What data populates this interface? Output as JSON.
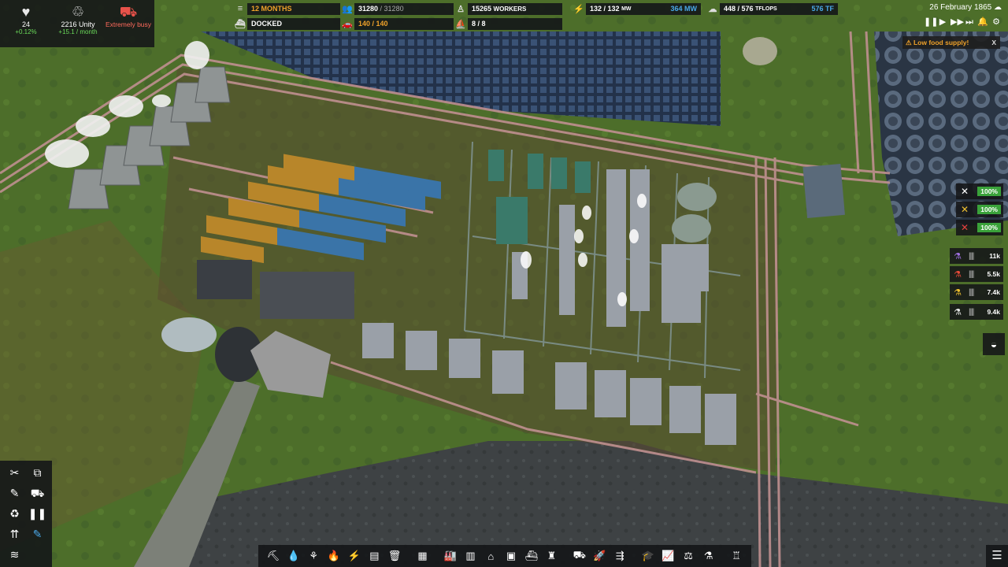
{
  "stats": {
    "health": {
      "icon": "heart-pulse-icon",
      "value": "24",
      "sub": "+0.12%"
    },
    "unity": {
      "icon": "unity-icon",
      "value": "2216 Unity",
      "sub": "+15.1 / month"
    },
    "logistics": {
      "icon": "truck-icon",
      "label": "Extremely busy"
    }
  },
  "topbar": {
    "food_months": "12 MONTHS",
    "ship_status": "DOCKED",
    "population": "31280",
    "population_max": "/ 31280",
    "workers": "15265",
    "workers_label": "WORKERS",
    "vehicles": "140 / 140",
    "ships": "8 / 8",
    "power": "132 / 132",
    "power_unit": "MW",
    "power_cap": "364 MW",
    "computing": "448 / 576",
    "computing_unit": "TFLOPS",
    "computing_cap": "576 TF"
  },
  "date": "26 February 1865",
  "alert": {
    "text": "Low food supply!",
    "close": "X"
  },
  "efficiency": [
    {
      "icon": "wrench-icon",
      "value": "100%",
      "color": "#ffffff"
    },
    {
      "icon": "tools-yellow-icon",
      "value": "100%",
      "color": "#f0c030"
    },
    {
      "icon": "tools-red-icon",
      "value": "100%",
      "color": "#e84040"
    }
  ],
  "resources": [
    {
      "icon": "flask-purple-icon",
      "value": "11k",
      "color": "#a070e0"
    },
    {
      "icon": "flask-red-icon",
      "value": "5.5k",
      "color": "#e84a3a"
    },
    {
      "icon": "flask-yellow-icon",
      "value": "7.4k",
      "color": "#f0c030"
    },
    {
      "icon": "flask-white-icon",
      "value": "9.4k",
      "color": "#e8e8e8"
    }
  ],
  "colors": {
    "accent": "#f0a22a",
    "blue": "#4aa8e8",
    "green": "#3aa23a",
    "panel": "#141618"
  }
}
